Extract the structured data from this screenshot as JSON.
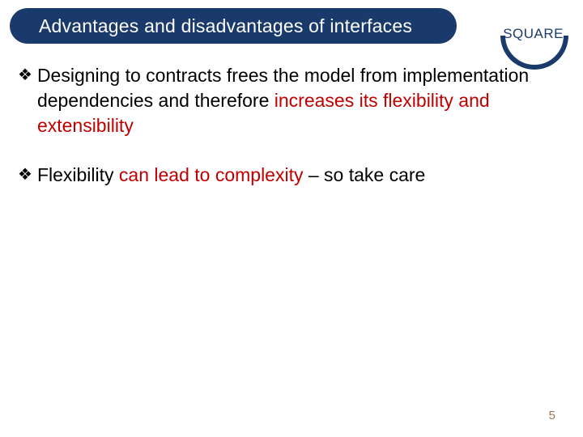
{
  "header": {
    "title": "Advantages and disadvantages of interfaces"
  },
  "logo": {
    "text": "SQUARE"
  },
  "bullets": [
    {
      "segments": [
        {
          "text": "Designing to contracts frees the model from implementation dependencies and therefore ",
          "highlight": false
        },
        {
          "text": "increases its flexibility and extensibility",
          "highlight": true
        }
      ]
    },
    {
      "segments": [
        {
          "text": "Flexibility ",
          "highlight": false
        },
        {
          "text": "can lead to complexity",
          "highlight": true
        },
        {
          "text": " – so take care",
          "highlight": false
        }
      ]
    }
  ],
  "page_number": "5",
  "bullet_glyph": "❖"
}
